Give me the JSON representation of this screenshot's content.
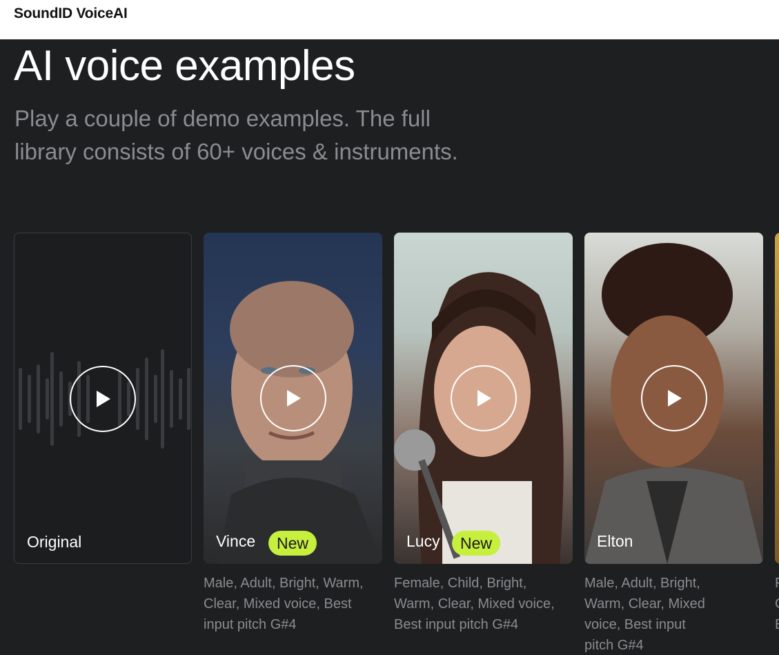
{
  "header": {
    "brand": "SoundID VoiceAI"
  },
  "hero": {
    "title": "AI voice examples",
    "subtitle_line1": "Play a couple of demo examples. The full",
    "subtitle_line2": "library consists of 60+ voices & instruments."
  },
  "cards": [
    {
      "name": "Original",
      "badge": "",
      "description": ""
    },
    {
      "name": "Vince",
      "badge": "New",
      "desc_lines": [
        "Male, Adult, Bright, Warm,",
        "Clear, Mixed voice, Best",
        "input pitch  G#4"
      ]
    },
    {
      "name": "Lucy",
      "badge": "New",
      "desc_lines": [
        "Female, Child, Bright,",
        "Warm, Clear, Mixed voice,",
        "Best input pitch  G#4"
      ]
    },
    {
      "name": "Elton",
      "badge": "",
      "desc_lines": [
        "Male, Adult, Bright,",
        "Warm, Clear, Mixed",
        "voice, Best input",
        "pitch  G#4"
      ]
    }
  ],
  "peek_desc_lines": [
    "F",
    "C",
    "B"
  ],
  "colors": {
    "background": "#1e1f21",
    "badge": "#c6ef3e",
    "muted_text": "#8b8c8f"
  },
  "icons": {
    "play": "play-icon"
  }
}
